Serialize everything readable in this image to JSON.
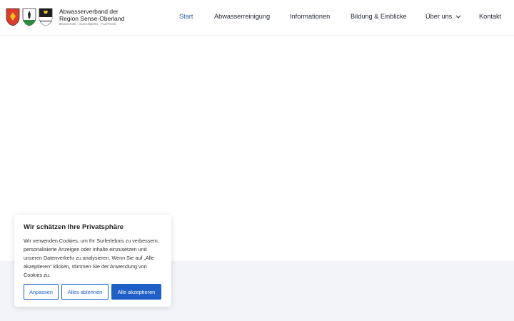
{
  "header": {
    "org_line1": "Abwasserverband der",
    "org_line2": "Region Sense-Oberland",
    "org_line3": "BRÜNISRIED · GUGGISBERG · PLAFFEIEN"
  },
  "nav": {
    "items": [
      {
        "label": "Start",
        "active": true
      },
      {
        "label": "Abwasserreinigung"
      },
      {
        "label": "Informationen"
      },
      {
        "label": "Bildung & Einblicke"
      },
      {
        "label": "Über uns",
        "icon": "chevron-down-icon"
      },
      {
        "label": "Kontakt"
      }
    ]
  },
  "cookie": {
    "title": "Wir schätzen Ihre Privatsphäre",
    "text": "Wir verwenden Cookies, um Ihr Surferlebnis zu verbessern, personalisierte Anzeigen oder Inhalte einzusetzen und unseren Datenverkehr zu analysieren. Wenn Sie auf „Alle akzeptieren“ klicken, stimmen Sie der Anwendung von Cookies zu.",
    "btn_customize": "Anpassen",
    "btn_reject": "Alles ablehnen",
    "btn_accept": "Alle akzeptieren"
  },
  "colors": {
    "accent": "#1f5fc8",
    "active_nav": "#2f5b9c",
    "band": "#f2f4f8"
  }
}
